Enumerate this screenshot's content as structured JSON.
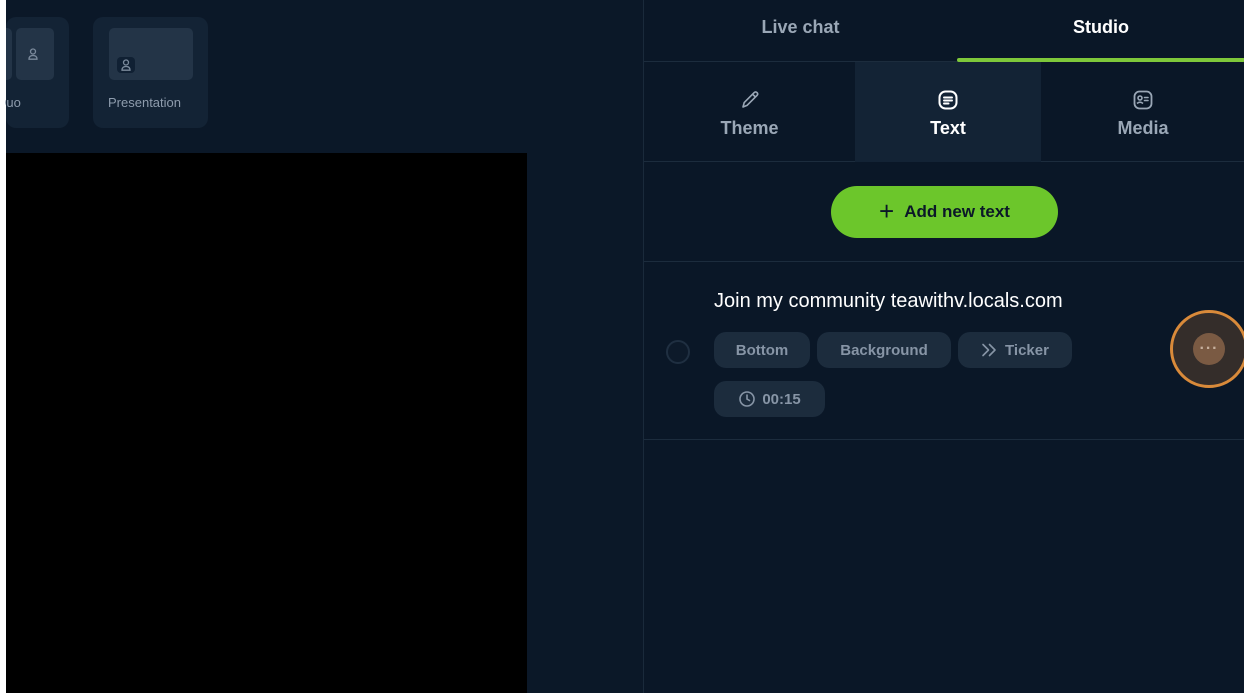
{
  "layouts": {
    "duo_label": "Duo",
    "presentation_label": "Presentation"
  },
  "panel": {
    "tabs": [
      {
        "label": "Live chat",
        "active": false
      },
      {
        "label": "Studio",
        "active": true
      }
    ],
    "subtabs": [
      {
        "label": "Theme",
        "icon": "pencil-icon",
        "active": false
      },
      {
        "label": "Text",
        "icon": "text-box-icon",
        "active": true
      },
      {
        "label": "Media",
        "icon": "media-id-icon",
        "active": false
      }
    ],
    "add_button_label": "Add new text",
    "text_items": [
      {
        "title": "Join my community teawithv.locals.com",
        "chips": [
          "Bottom",
          "Background",
          "Ticker"
        ],
        "duration": "00:15"
      }
    ]
  },
  "colors": {
    "accent": "#6cc62b",
    "background": "#0b1828",
    "highlight_ring": "#d98a3a"
  }
}
